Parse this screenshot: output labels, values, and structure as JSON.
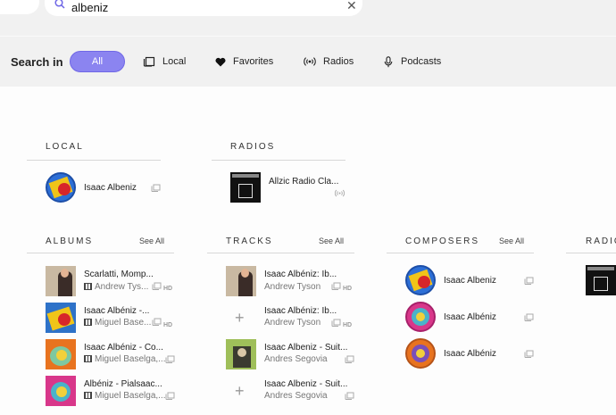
{
  "search": {
    "value": "albeniz",
    "clear_icon": "close-icon"
  },
  "nav": {
    "back_icon": "chevron-left-icon",
    "forward_icon": "chevron-right-icon"
  },
  "filters": {
    "label": "Search in",
    "items": [
      {
        "label": "All",
        "icon": "",
        "active": true
      },
      {
        "label": "Local",
        "icon": "local-library-icon"
      },
      {
        "label": "Favorites",
        "icon": "heart-icon"
      },
      {
        "label": "Radios",
        "icon": "radio-waves-icon"
      },
      {
        "label": "Podcasts",
        "icon": "microphone-icon"
      }
    ],
    "accent": "#8b84f0"
  },
  "sections": {
    "local": {
      "title": "LOCAL",
      "items": [
        {
          "title": "Isaac Albeniz"
        }
      ]
    },
    "radios_top": {
      "title": "RADIOS",
      "items": [
        {
          "title": "Allzic Radio Cla..."
        }
      ]
    },
    "albums": {
      "title": "ALBUMS",
      "see_all": "See All",
      "items": [
        {
          "title": "Scarlatti, Momp...",
          "subtitle": "Andrew Tys...",
          "badge": "HD"
        },
        {
          "title": "Isaac Albéniz -...",
          "subtitle": "Miguel Base...",
          "badge": "HD"
        },
        {
          "title": "Isaac Albéniz - Co...",
          "subtitle": "Miguel Baselga,..."
        },
        {
          "title": "Albéniz - Pialsaac...",
          "subtitle": "Miguel Baselga,..."
        }
      ]
    },
    "tracks": {
      "title": "TRACKS",
      "see_all": "See All",
      "items": [
        {
          "title": "Isaac Albéniz: Ib...",
          "subtitle": "Andrew Tyson",
          "badge": "HD"
        },
        {
          "title": "Isaac Albéniz: Ib...",
          "subtitle": "Andrew Tyson",
          "badge": "HD"
        },
        {
          "title": "Isaac Albeniz - Suit...",
          "subtitle": "Andres Segovia"
        },
        {
          "title": "Isaac Albeniz - Suit...",
          "subtitle": "Andres Segovia"
        }
      ]
    },
    "composers": {
      "title": "COMPOSERS",
      "see_all": "See All",
      "items": [
        {
          "title": "Isaac Albeniz"
        },
        {
          "title": "Isaac Albéniz"
        },
        {
          "title": "Isaac Albéniz"
        }
      ]
    },
    "radios_right": {
      "title": "RADIO"
    }
  }
}
